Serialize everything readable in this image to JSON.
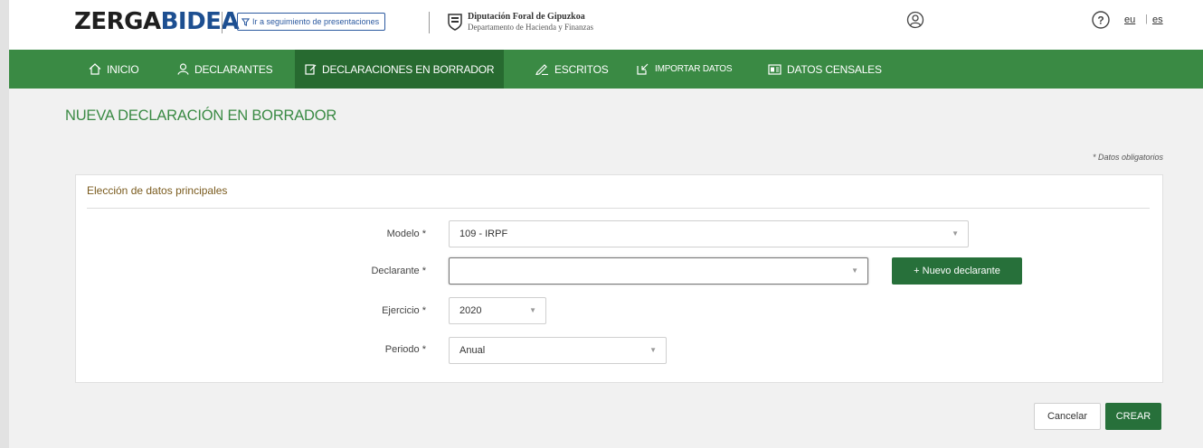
{
  "header": {
    "logo_a": "ZERGA",
    "logo_b": "BIDEA",
    "tracking_link": "Ir a seguimiento de presentaciones",
    "org_title": "Diputación Foral de Gipuzkoa",
    "org_subtitle": "Departamento de Hacienda y Finanzas",
    "lang_eu": "eu",
    "lang_sep": "|",
    "lang_es": "es"
  },
  "nav": {
    "items": [
      {
        "label": "INICIO",
        "icon": "home-icon"
      },
      {
        "label": "DECLARANTES",
        "icon": "user-icon"
      },
      {
        "label": "DECLARACIONES EN BORRADOR",
        "icon": "edit-icon"
      },
      {
        "label": "ESCRITOS",
        "icon": "pen-icon"
      },
      {
        "label": "IMPORTAR DATOS",
        "icon": "import-icon"
      },
      {
        "label": "DATOS CENSALES",
        "icon": "id-card-icon"
      }
    ],
    "active": "DECLARACIONES EN BORRADOR"
  },
  "page": {
    "title": "NUEVA DECLARACIÓN EN BORRADOR",
    "required_note": "* Datos obligatorios"
  },
  "panel": {
    "title": "Elección de datos principales",
    "fields": {
      "modelo": {
        "label": "Modelo *",
        "value": "109 - IRPF"
      },
      "declarante": {
        "label": "Declarante *",
        "value": ""
      },
      "ejercicio": {
        "label": "Ejercicio *",
        "value": "2020"
      },
      "periodo": {
        "label": "Periodo *",
        "value": "Anual"
      }
    },
    "new_declarant_button": "+ Nuevo declarante"
  },
  "actions": {
    "cancel": "Cancelar",
    "create": "CREAR"
  },
  "colors": {
    "nav_green": "#3a8a44",
    "nav_active": "#276a30",
    "button_green": "#27703a",
    "title_green": "#3a8a44",
    "panel_title": "#7a5b1e"
  }
}
